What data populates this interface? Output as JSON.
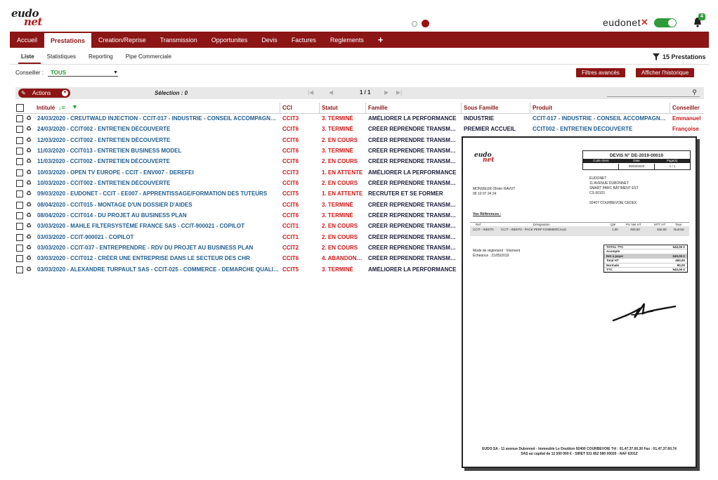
{
  "brand": {
    "logo_top": "eudo",
    "logo_bottom": "net",
    "name": "eudonet",
    "x_mark": "✕",
    "notification_count": "4"
  },
  "nav": {
    "items": [
      "Accueil",
      "Prestations",
      "Creation/Reprise",
      "Transmission",
      "Opportunites",
      "Devis",
      "Factures",
      "Reglements"
    ],
    "active": "Prestations",
    "plus": "+"
  },
  "subtabs": [
    "Liste",
    "Statistiques",
    "Reporting",
    "Pipe Commerciale"
  ],
  "count_label": "15 Prestations",
  "conseiller": {
    "label": "Conseiller :",
    "value": "TOUS"
  },
  "buttons": {
    "filters": "Filtres avancés",
    "history": "Afficher l'historique"
  },
  "toolbar": {
    "actions_label": "Actions",
    "selection": "Sélection : 0",
    "page": "1 / 1"
  },
  "table": {
    "columns": [
      "Intitulé",
      "CCI",
      "Statut",
      "Famille",
      "Sous Famille",
      "Produit",
      "Conseiller"
    ],
    "rows": [
      {
        "intitule": "24/03/2020 - CREUTWALD INJECTION - CCIT-017 - INDUSTRIE - CONSEIL ACCOMPAGNEMENT I...",
        "cci": "CCIT3",
        "statut": "3. TERMINÉ",
        "famille": "AMÉLIORER LA PERFORMANCE",
        "sous_famille": "INDUSTRIE",
        "produit": "CCIT-017 - INDUSTRIE - CONSEIL ACCOMPAGNEMEN...",
        "conseiller": "Emmanuel"
      },
      {
        "intitule": "24/03/2020 - CCIT002 - ENTRETIEN DÉCOUVERTE",
        "cci": "CCIT6",
        "statut": "3. TERMINÉ",
        "famille": "CRÉER REPRENDRE TRANSMETTRE",
        "sous_famille": "PREMIER ACCUEIL",
        "produit": "CCIT002 - ENTRETIEN DÉCOUVERTE",
        "conseiller": "Françoise"
      },
      {
        "intitule": "12/03/2020 - CCIT002 - ENTRETIEN DÉCOUVERTE",
        "cci": "CCIT6",
        "statut": "2. EN COURS",
        "famille": "CRÉER REPRENDRE TRANSMETTRE",
        "sous_famille": "",
        "produit": "",
        "conseiller": ""
      },
      {
        "intitule": "11/03/2020 - CCIT013 - ENTRETIEN BUSINESS MODEL",
        "cci": "CCIT6",
        "statut": "3. TERMINÉ",
        "famille": "CRÉER REPRENDRE TRANSMETTRE",
        "sous_famille": "",
        "produit": "",
        "conseiller": ""
      },
      {
        "intitule": "11/03/2020 - CCIT002 - ENTRETIEN DÉCOUVERTE",
        "cci": "CCIT6",
        "statut": "2. EN COURS",
        "famille": "CRÉER REPRENDRE TRANSMETTRE",
        "sous_famille": "",
        "produit": "",
        "conseiller": ""
      },
      {
        "intitule": "10/03/2020 - OPEN TV EUROPE - CCIT - ENV007 - DEREFEI",
        "cci": "CCIT3",
        "statut": "1. EN ATTENTE",
        "famille": "AMÉLIORER LA PERFORMANCE",
        "sous_famille": "",
        "produit": "",
        "conseiller": ""
      },
      {
        "intitule": "10/03/2020 - CCIT002 - ENTRETIEN DÉCOUVERTE",
        "cci": "CCIT6",
        "statut": "2. EN COURS",
        "famille": "CRÉER REPRENDRE TRANSMETTRE",
        "sous_famille": "",
        "produit": "",
        "conseiller": ""
      },
      {
        "intitule": "09/03/2020 - EUDONET - CCIT - EE007 - APPRENTISSAGE/FORMATION DES TUTEURS",
        "cci": "CCIT5",
        "statut": "1. EN ATTENTE",
        "famille": "RECRUTER ET SE FORMER",
        "sous_famille": "",
        "produit": "",
        "conseiller": ""
      },
      {
        "intitule": "08/04/2020 - CCIT015 - MONTAGE D'UN DOSSIER D'AIDES",
        "cci": "CCIT6",
        "statut": "3. TERMINÉ",
        "famille": "CRÉER REPRENDRE TRANSMETTRE",
        "sous_famille": "",
        "produit": "",
        "conseiller": ""
      },
      {
        "intitule": "08/04/2020 - CCIT014 - DU PROJET AU BUSINESS PLAN",
        "cci": "CCIT6",
        "statut": "3. TERMINÉ",
        "famille": "CRÉER REPRENDRE TRANSMETTRE",
        "sous_famille": "",
        "produit": "",
        "conseiller": ""
      },
      {
        "intitule": "03/03/2020 - MAHLE FILTERSYSTÈME FRANCE SAS - CCIT-900021 - COPILOT",
        "cci": "CCIT1",
        "statut": "2. EN COURS",
        "famille": "CRÉER REPRENDRE TRANSMETTRE",
        "sous_famille": "",
        "produit": "",
        "conseiller": ""
      },
      {
        "intitule": "03/03/2020 - CCIT-900021 - COPILOT",
        "cci": "CCIT1",
        "statut": "2. EN COURS",
        "famille": "CRÉER REPRENDRE TRANSMETTRE",
        "sous_famille": "",
        "produit": "",
        "conseiller": ""
      },
      {
        "intitule": "03/03/2020 - CCIT-037 - ENTREPRENDRE - RDV DU PROJET AU BUSINESS PLAN",
        "cci": "CCIT2",
        "statut": "2. EN COURS",
        "famille": "CRÉER REPRENDRE TRANSMETTRE",
        "sous_famille": "",
        "produit": "",
        "conseiller": ""
      },
      {
        "intitule": "03/03/2020 - CCIT012 - CRÉER UNE ENTREPRISE DANS LE SECTEUR DES CHR",
        "cci": "CCIT6",
        "statut": "4. ABANDONNÉ",
        "famille": "CRÉER REPRENDRE TRANSMETTRE",
        "sous_famille": "",
        "produit": "",
        "conseiller": ""
      },
      {
        "intitule": "03/03/2020 - ALEXANDRE TURPAULT SAS - CCIT-025 - COMMERCE - DEMARCHE QUALITE PREF...",
        "cci": "CCIT5",
        "statut": "3. TERMINÉ",
        "famille": "AMÉLIORER LA PERFORMANCE",
        "sous_famille": "",
        "produit": "",
        "conseiller": ""
      }
    ]
  },
  "document": {
    "logo_top": "eudo",
    "logo_bottom": "net",
    "title": "DEVIS N° DE-2019-00010",
    "header_cols": [
      "Code client",
      "Date",
      "Page(s)"
    ],
    "header_vals": [
      "",
      "09/03/2020",
      "1 / 1"
    ],
    "contact": [
      "MONSIEUR Olivier RAVUT",
      "06 10 07 24 24"
    ],
    "address": [
      "EUDONET",
      "11 AVENUE DUBONNET",
      "SMART PARC BÂTIMENT EST",
      "CS 60101",
      "",
      "92407 COURBEVOIE CEDEX"
    ],
    "refs_label": "Vos Références :",
    "items_head": [
      "Ref",
      "Désignation",
      "Qté",
      "PU Net HT",
      "MTT HT",
      "Taxe"
    ],
    "items_row": [
      "CCIT - IND070",
      "CCIT - IND070 - PACK PERF'COMMERCIALE",
      "1,00",
      "450,00",
      "450,00",
      "Normal"
    ],
    "payment": [
      "Mode de règlement : Virement",
      "Échéance : 21/05/2019"
    ],
    "totals": [
      {
        "k": "TOTAL TTC",
        "v": "540,00 €",
        "shade": false
      },
      {
        "k": "Acompte",
        "v": "",
        "shade": false
      },
      {
        "k": "Net à payer",
        "v": "540,00 €",
        "shade": true
      },
      {
        "k": "Total HT",
        "v": "450,00",
        "shade": false
      },
      {
        "k": "Normale",
        "v": "90,00",
        "shade": false
      },
      {
        "k": "TTC",
        "v": "540,00 €",
        "shade": false
      }
    ],
    "footer": [
      "EUDO SA - 11 avenue Dubonnet - Immeuble Le Doublon 92400 COURBEVOIE Tél : 01.47.37.60.30 Fax : 01.47.37.60.74",
      "SAS au capital de 12 500 000 € - SIRET 531 852 580 00020 - NAF 6201Z"
    ]
  }
}
